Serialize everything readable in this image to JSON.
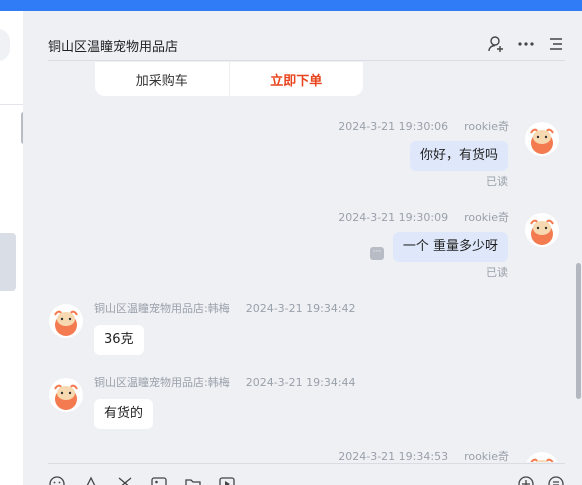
{
  "colors": {
    "accent": "#2f7cf6",
    "buy_now": "#e8451e",
    "bubble_me": "#dfe8fb",
    "bubble_other": "#ffffff"
  },
  "header": {
    "title": "铜山区温瞳宠物用品店",
    "icons": [
      "add-user-icon",
      "more-icon",
      "menu-icon"
    ]
  },
  "product_card": {
    "add_to_cart": "加采购车",
    "buy_now": "立即下单"
  },
  "messages": [
    {
      "side": "right",
      "time": "2024-3-21 19:30:06",
      "sender": "rookie奇",
      "text": "你好，有货吗",
      "status": "已读"
    },
    {
      "side": "right",
      "time": "2024-3-21 19:30:09",
      "sender": "rookie奇",
      "text": "一个 重量多少呀",
      "status": "已读",
      "badge": "···"
    },
    {
      "side": "left",
      "time": "2024-3-21 19:34:42",
      "sender": "铜山区温瞳宠物用品店:韩梅",
      "text": "36克"
    },
    {
      "side": "left",
      "time": "2024-3-21 19:34:44",
      "sender": "铜山区温瞳宠物用品店:韩梅",
      "text": "有货的"
    },
    {
      "side": "right",
      "time": "2024-3-21 19:34:53",
      "sender": "rookie奇"
    }
  ],
  "input_toolbar": {
    "icons": [
      "emoji-icon",
      "bell-icon",
      "scissors-icon",
      "image-icon",
      "folder-icon",
      "video-icon"
    ],
    "right_icons": [
      "add-circle-icon",
      "note-icon"
    ]
  }
}
